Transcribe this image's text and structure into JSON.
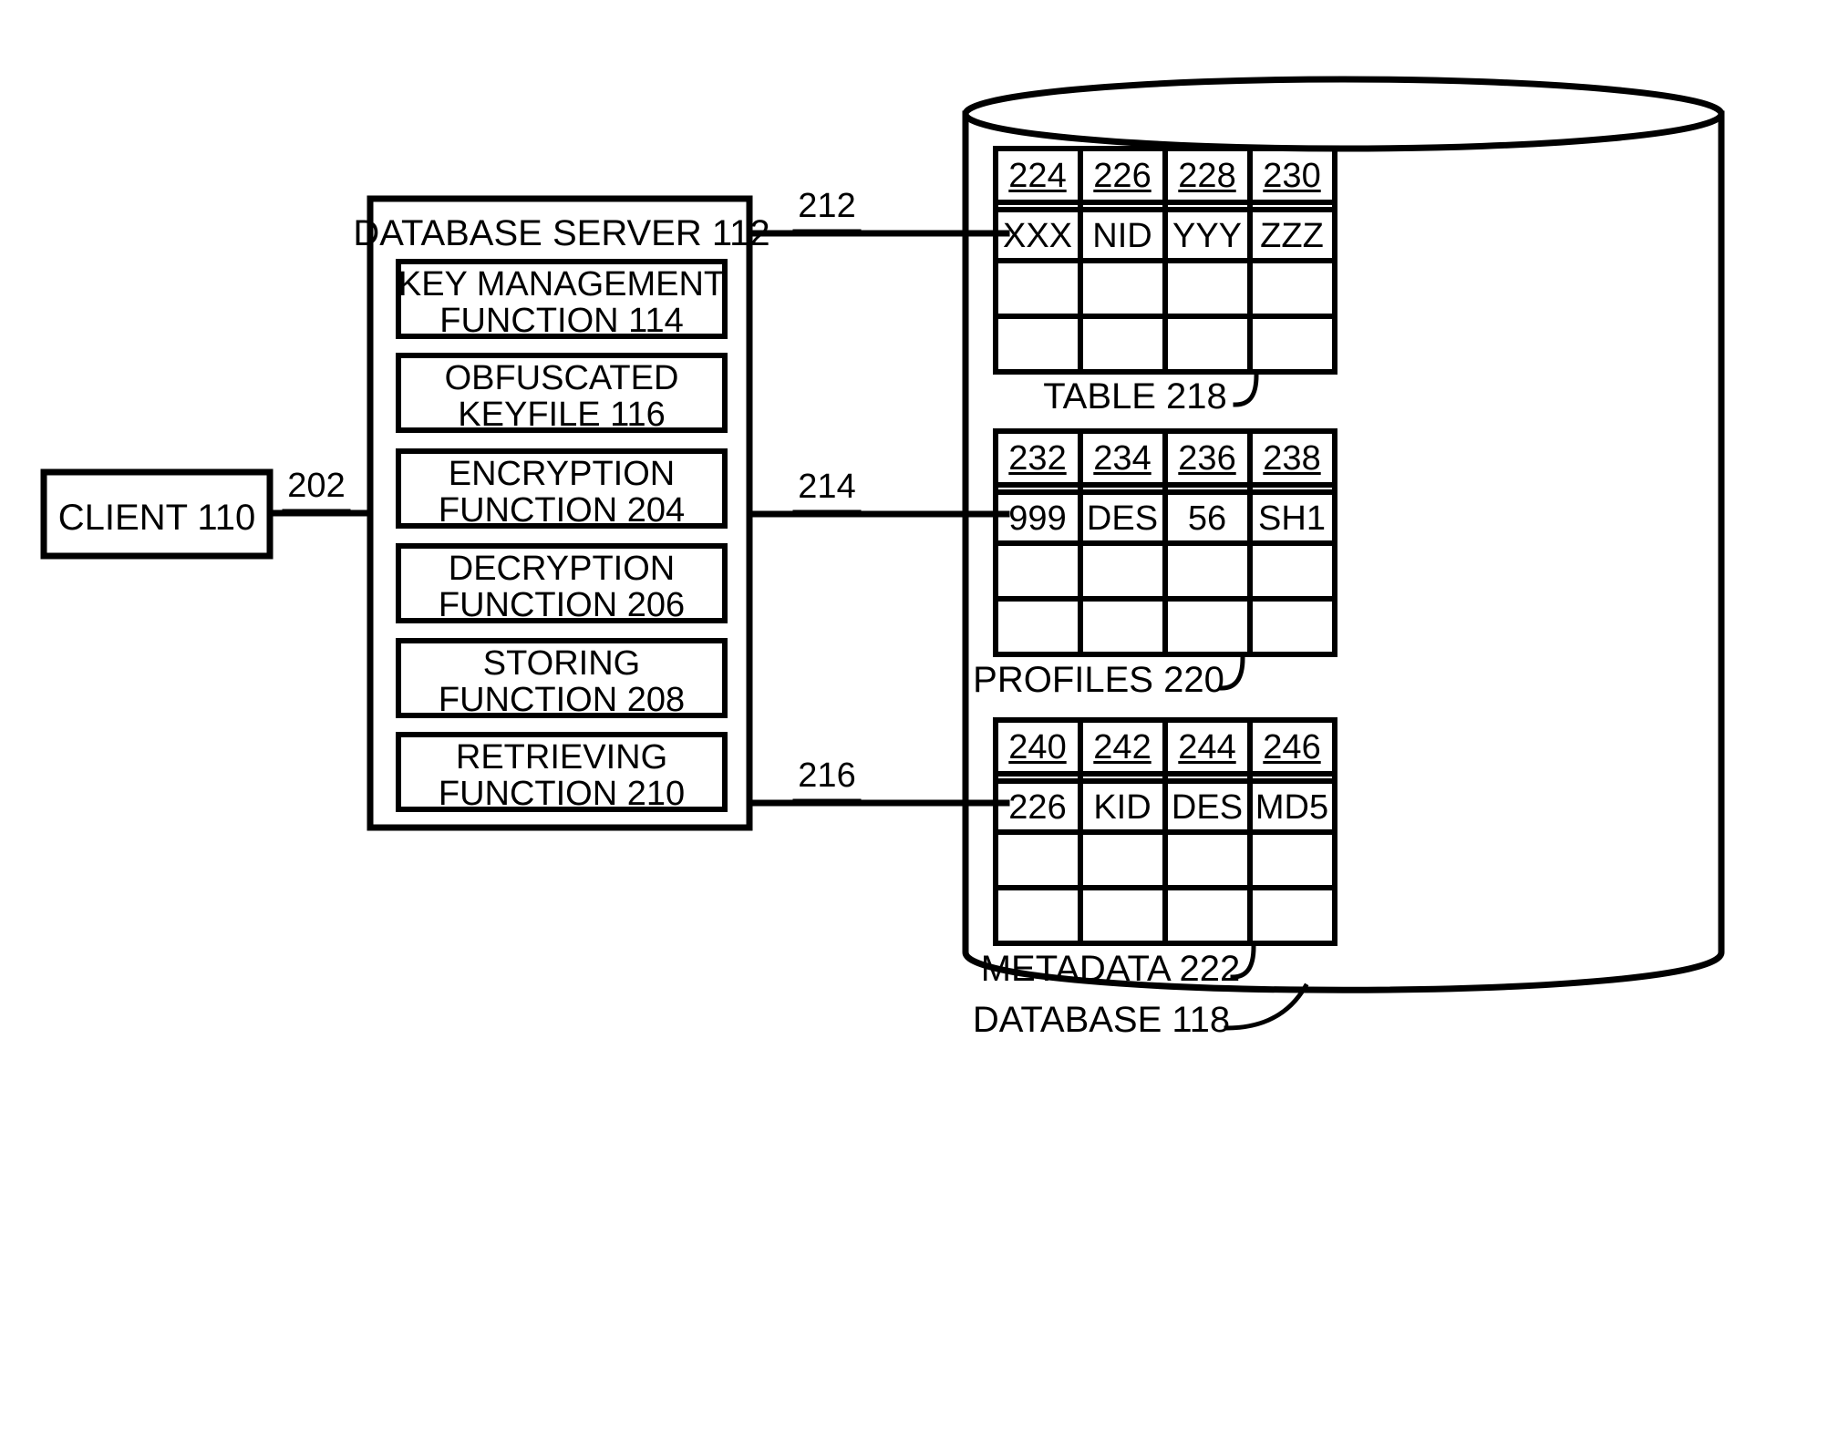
{
  "figure": {
    "title": "Database server and database block diagram",
    "stroke_color": "#000000",
    "background_color": "#ffffff"
  },
  "client": {
    "label": "CLIENT 110",
    "connector_label": "202"
  },
  "server": {
    "title": "DATABASE SERVER 112",
    "functions": [
      {
        "line1": "KEY MANAGEMENT",
        "line2": "FUNCTION 114"
      },
      {
        "line1": "OBFUSCATED",
        "line2": "KEYFILE 116"
      },
      {
        "line1": "ENCRYPTION",
        "line2": "FUNCTION 204"
      },
      {
        "line1": "DECRYPTION",
        "line2": "FUNCTION 206"
      },
      {
        "line1": "STORING",
        "line2": "FUNCTION 208"
      },
      {
        "line1": "RETRIEVING",
        "line2": "FUNCTION 210"
      }
    ]
  },
  "connectors": [
    {
      "label": "212"
    },
    {
      "label": "214"
    },
    {
      "label": "216"
    }
  ],
  "database": {
    "label": "DATABASE 118",
    "tables": [
      {
        "caption": "TABLE 218",
        "headers": [
          "224",
          "226",
          "228",
          "230"
        ],
        "rows": [
          [
            "XXX",
            "NID",
            "YYY",
            "ZZZ"
          ],
          [
            "",
            "",
            "",
            ""
          ],
          [
            "",
            "",
            "",
            ""
          ]
        ]
      },
      {
        "caption": "PROFILES 220",
        "headers": [
          "232",
          "234",
          "236",
          "238"
        ],
        "rows": [
          [
            "999",
            "DES",
            "56",
            "SH1"
          ],
          [
            "",
            "",
            "",
            ""
          ],
          [
            "",
            "",
            "",
            ""
          ]
        ]
      },
      {
        "caption": "METADATA 222",
        "headers": [
          "240",
          "242",
          "244",
          "246"
        ],
        "rows": [
          [
            "226",
            "KID",
            "DES",
            "MD5"
          ],
          [
            "",
            "",
            "",
            ""
          ],
          [
            "",
            "",
            "",
            ""
          ]
        ]
      }
    ]
  }
}
